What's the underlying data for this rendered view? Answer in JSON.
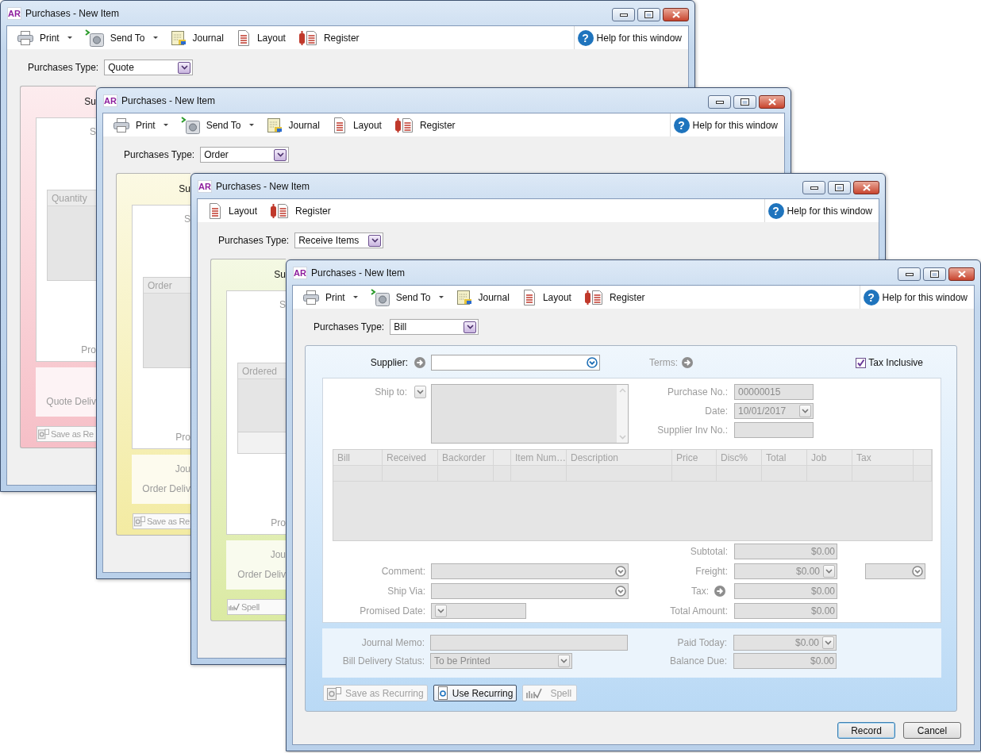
{
  "windows": [
    {
      "title": "Purchases - New Item",
      "app_icon": "AR",
      "color": "#f6bfc7",
      "toolbar": [
        {
          "kind": "print",
          "label": "Print",
          "dropdown": true
        },
        {
          "kind": "send",
          "label": "Send To",
          "dropdown": true
        },
        {
          "kind": "journal",
          "label": "Journal",
          "dropdown": false
        },
        {
          "kind": "layout",
          "label": "Layout",
          "dropdown": false
        },
        {
          "kind": "register",
          "label": "Register",
          "dropdown": false
        }
      ],
      "help": {
        "icon": "?",
        "label": "Help for this window"
      },
      "purchases_type": {
        "label": "Purchases Type:",
        "value": "Quote"
      },
      "visible_part": {
        "supplier_label": "Su",
        "ship_to_label": "S",
        "column": "Quantity",
        "totals_row": false,
        "promised_date_label": "Pro",
        "delivery_label": "Quote Deliv",
        "button": {
          "kind": "recurring",
          "label": "Save as Re"
        }
      }
    },
    {
      "title": "Purchases - New Item",
      "app_icon": "AR",
      "color": "#f3eba2",
      "toolbar": [
        {
          "kind": "print",
          "label": "Print",
          "dropdown": true
        },
        {
          "kind": "send",
          "label": "Send To",
          "dropdown": true
        },
        {
          "kind": "journal",
          "label": "Journal",
          "dropdown": false
        },
        {
          "kind": "layout",
          "label": "Layout",
          "dropdown": false
        },
        {
          "kind": "register",
          "label": "Register",
          "dropdown": false
        }
      ],
      "help": {
        "icon": "?",
        "label": "Help for this window"
      },
      "purchases_type": {
        "label": "Purchases Type:",
        "value": "Order"
      },
      "visible_part": {
        "supplier_label": "Su",
        "ship_to_label": "S",
        "column": "Order",
        "totals_row": false,
        "promised_date_label": "Pro",
        "memo_label": "Jou",
        "delivery_label": "Order Deliv",
        "button": {
          "kind": "recurring",
          "label": "Save as Re"
        }
      }
    },
    {
      "title": "Purchases - New Item",
      "app_icon": "AR",
      "color": "#dbeaa3",
      "toolbar": [
        {
          "kind": "layout",
          "label": "Layout",
          "dropdown": false
        },
        {
          "kind": "register",
          "label": "Register",
          "dropdown": false
        }
      ],
      "help": {
        "icon": "?",
        "label": "Help for this window"
      },
      "purchases_type": {
        "label": "Purchases Type:",
        "value": "Receive Items"
      },
      "visible_part": {
        "supplier_label": "Su",
        "ship_to_label": "S",
        "column": "Ordered",
        "totals_row": true,
        "promised_date_label": "Pro",
        "memo_label": "Jou",
        "delivery_label": "Order Deliv",
        "button": {
          "kind": "spell",
          "label": "Spell"
        }
      }
    },
    {
      "title": "Purchases - New Item",
      "app_icon": "AR",
      "color": "#b9d9f5",
      "toolbar": [
        {
          "kind": "print",
          "label": "Print",
          "dropdown": true
        },
        {
          "kind": "send",
          "label": "Send To",
          "dropdown": true
        },
        {
          "kind": "journal",
          "label": "Journal",
          "dropdown": false
        },
        {
          "kind": "layout",
          "label": "Layout",
          "dropdown": false
        },
        {
          "kind": "register",
          "label": "Register",
          "dropdown": false
        }
      ],
      "help": {
        "icon": "?",
        "label": "Help for this window"
      },
      "purchases_type": {
        "label": "Purchases Type:",
        "value": "Bill"
      },
      "form": {
        "supplier": {
          "label": "Supplier:"
        },
        "terms": {
          "label": "Terms:"
        },
        "tax_inclusive": {
          "label": "Tax Inclusive",
          "checked": true
        },
        "ship_to": {
          "label": "Ship to:"
        },
        "header_fields": [
          {
            "kind": "text",
            "label": "Purchase No.:",
            "value": "00000015"
          },
          {
            "kind": "date",
            "label": "Date:",
            "value": "10/01/2017"
          },
          {
            "kind": "text",
            "label": "Supplier Inv No.:"
          }
        ],
        "columns": [
          {
            "kind": "text",
            "label": "Bill"
          },
          {
            "kind": "text",
            "label": "Received"
          },
          {
            "kind": "text",
            "label": "Backorder"
          },
          {
            "kind": "blank"
          },
          {
            "kind": "text",
            "label": "Item Num…"
          },
          {
            "kind": "text",
            "label": "Description"
          },
          {
            "kind": "text",
            "label": "Price"
          },
          {
            "kind": "text",
            "label": "Disc%"
          },
          {
            "kind": "text",
            "label": "Total"
          },
          {
            "kind": "text",
            "label": "Job"
          },
          {
            "kind": "text",
            "label": "Tax"
          },
          {
            "kind": "blank"
          }
        ],
        "left_fields": [
          {
            "kind": "none"
          },
          {
            "kind": "combo",
            "label": "Comment:"
          },
          {
            "kind": "combo",
            "label": "Ship Via:"
          },
          {
            "kind": "date",
            "label": "Promised Date:"
          }
        ],
        "totals": [
          {
            "kind": "plain",
            "label": "Subtotal:",
            "value": "$0.00",
            "tax_code_combo": false
          },
          {
            "kind": "dropdown",
            "label": "Freight:",
            "value": "$0.00",
            "tax_code_combo": true
          },
          {
            "kind": "link",
            "label": "Tax:",
            "value": "$0.00",
            "tax_code_combo": false
          },
          {
            "kind": "plain",
            "label": "Total Amount:",
            "value": "$0.00",
            "tax_code_combo": false
          }
        ],
        "memo_fields": [
          {
            "kind": "text",
            "label": "Journal Memo:"
          },
          {
            "kind": "dropdown",
            "label": "Bill Delivery Status:",
            "value": "To be Printed"
          }
        ],
        "payment_fields": [
          {
            "kind": "dropdown",
            "label": "Paid Today:",
            "value": "$0.00"
          },
          {
            "kind": "plain",
            "label": "Balance Due:",
            "value": "$0.00"
          }
        ],
        "actions": [
          {
            "kind": "save-recurring",
            "label": "Save as Recurring",
            "disabled": true
          },
          {
            "kind": "use-recurring",
            "label": "Use Recurring",
            "disabled": false
          },
          {
            "kind": "spell",
            "label": "Spell",
            "disabled": true
          }
        ],
        "buttons": [
          {
            "label": "Record",
            "default": true
          },
          {
            "label": "Cancel",
            "default": false
          }
        ]
      }
    }
  ]
}
